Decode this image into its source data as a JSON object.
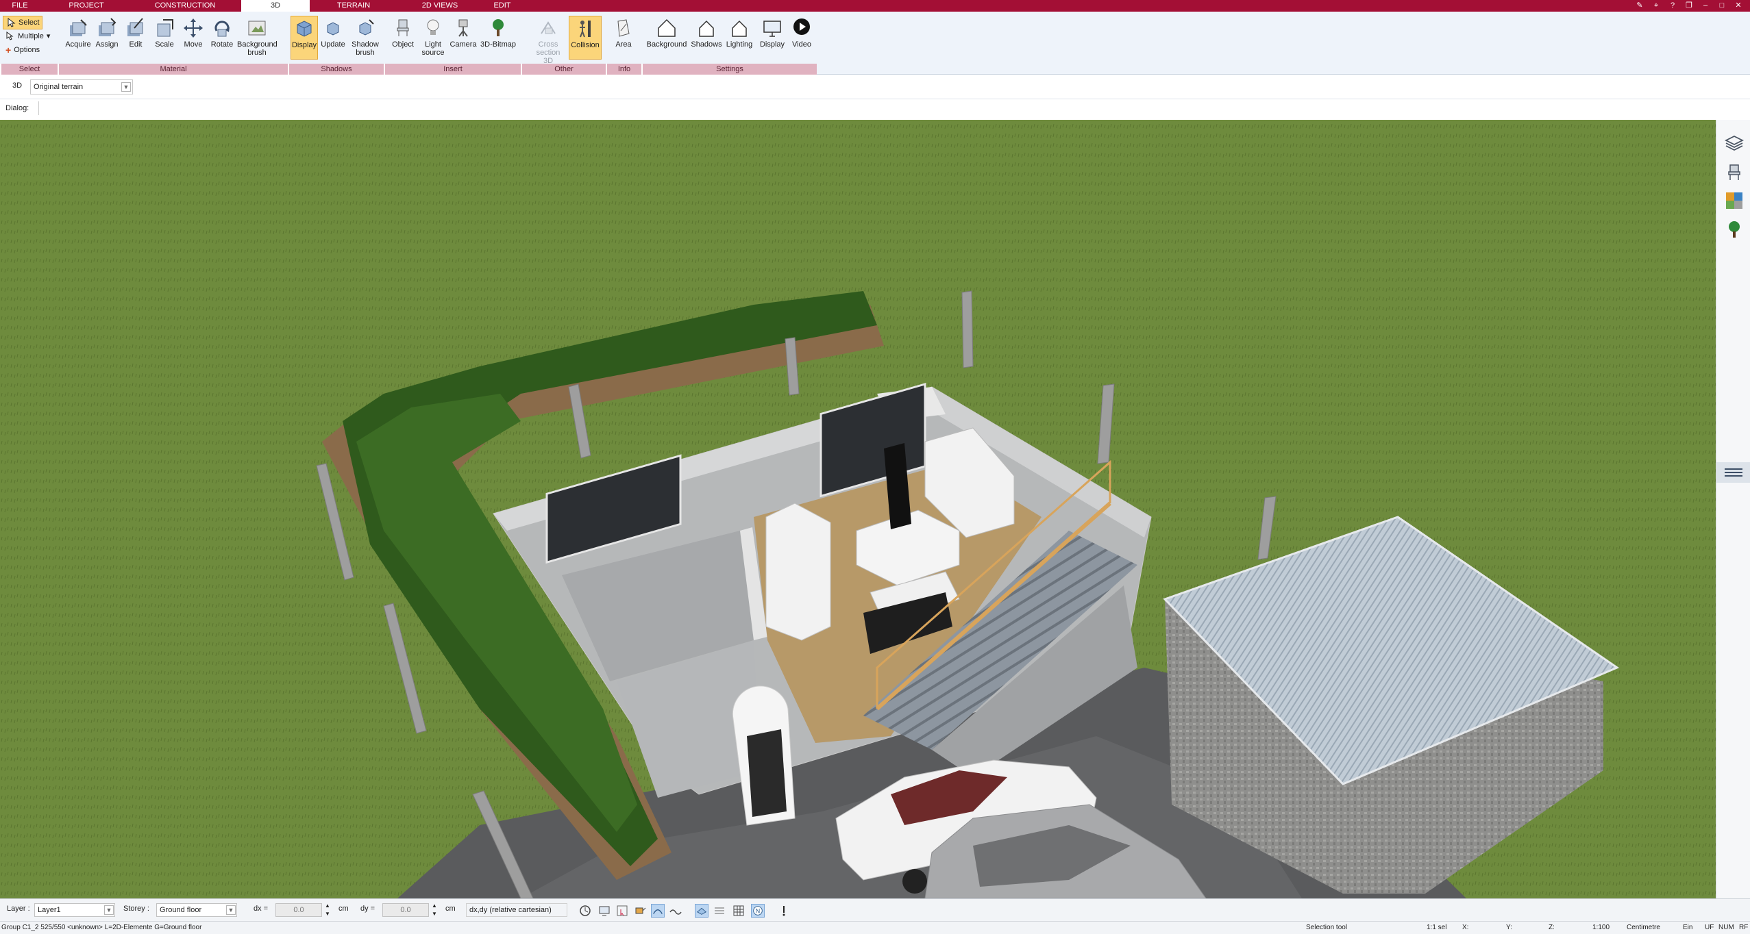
{
  "tabs": [
    {
      "label": "FILE",
      "active": false
    },
    {
      "label": "PROJECT",
      "active": false
    },
    {
      "label": "CONSTRUCTION",
      "active": false
    },
    {
      "label": "3D",
      "active": true
    },
    {
      "label": "TERRAIN",
      "active": false
    },
    {
      "label": "2D VIEWS",
      "active": false
    },
    {
      "label": "EDIT",
      "active": false
    }
  ],
  "ribbon": {
    "select": {
      "select": "Select",
      "multiple": "Multiple",
      "options": "Options",
      "group": "Select"
    },
    "material": {
      "acquire": "Acquire",
      "assign": "Assign",
      "edit": "Edit",
      "scale": "Scale",
      "move": "Move",
      "rotate": "Rotate",
      "background_brush": "Background\nbrush",
      "group": "Material"
    },
    "shadows": {
      "display": "Display",
      "update": "Update",
      "shadow_brush": "Shadow\nbrush",
      "group": "Shadows"
    },
    "insert": {
      "object": "Object",
      "light_source": "Light\nsource",
      "camera": "Camera",
      "bitmap": "3D-Bitmap",
      "group": "Insert"
    },
    "other": {
      "cross_section": "Cross\nsection 3D",
      "collision": "Collision",
      "group": "Other"
    },
    "info": {
      "area": "Area",
      "group": "Info"
    },
    "settings": {
      "background": "Background",
      "shadows": "Shadows",
      "lighting": "Lighting",
      "display": "Display",
      "video": "Video",
      "group": "Settings"
    }
  },
  "viewbar": {
    "mode": "3D",
    "terrain": "Original terrain"
  },
  "dialog": {
    "label": "Dialog:"
  },
  "inputbar": {
    "layer_label": "Layer :",
    "layer_value": "Layer1",
    "storey_label": "Storey :",
    "storey_value": "Ground floor",
    "dx_label": "dx =",
    "dx_value": "0.0",
    "dx_unit": "cm",
    "dy_label": "dy =",
    "dy_value": "0.0",
    "dy_unit": "cm",
    "coord_mode": "dx,dy (relative cartesian)"
  },
  "statusbar": {
    "info": "Group C1_2 525/550 <unknown> L=2D-Elemente G=Ground floor",
    "tool": "Selection tool",
    "sel": "1:1 sel",
    "x": "X:",
    "y": "Y:",
    "z": "Z:",
    "scale": "1:100",
    "unit": "Centimetre",
    "lang": "Ein",
    "uf": "UF",
    "num": "NUM",
    "rf": "RF"
  },
  "colors": {
    "accent": "#a30f35",
    "ribbon_bg": "#eef3fa",
    "active_button": "#fbd57a",
    "grass": "#6d8a3c"
  },
  "icons": [
    "select-arrow-icon",
    "multiple-icon",
    "options-plus-icon",
    "acquire-icon",
    "assign-icon",
    "edit-icon",
    "scale-icon",
    "move-icon",
    "rotate-icon",
    "background-brush-icon",
    "display-cube-icon",
    "update-icon",
    "shadow-brush-icon",
    "object-chair-icon",
    "light-bulb-icon",
    "camera-icon",
    "tree-bitmap-icon",
    "cross-section-icon",
    "collision-icon",
    "area-icon",
    "background-house-icon",
    "shadows-house-icon",
    "lighting-house-icon",
    "display-monitor-icon",
    "video-play-icon",
    "layers-icon",
    "chair-icon",
    "materials-icon",
    "tree-icon"
  ]
}
